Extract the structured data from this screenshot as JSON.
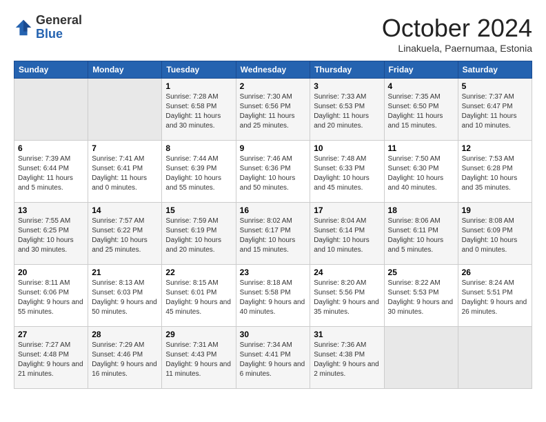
{
  "header": {
    "logo": {
      "line1": "General",
      "line2": "Blue"
    },
    "title": "October 2024",
    "subtitle": "Linakuela, Paernumaa, Estonia"
  },
  "days_of_week": [
    "Sunday",
    "Monday",
    "Tuesday",
    "Wednesday",
    "Thursday",
    "Friday",
    "Saturday"
  ],
  "weeks": [
    [
      {
        "day": "",
        "empty": true
      },
      {
        "day": "",
        "empty": true
      },
      {
        "day": "1",
        "sunrise": "Sunrise: 7:28 AM",
        "sunset": "Sunset: 6:58 PM",
        "daylight": "Daylight: 11 hours and 30 minutes."
      },
      {
        "day": "2",
        "sunrise": "Sunrise: 7:30 AM",
        "sunset": "Sunset: 6:56 PM",
        "daylight": "Daylight: 11 hours and 25 minutes."
      },
      {
        "day": "3",
        "sunrise": "Sunrise: 7:33 AM",
        "sunset": "Sunset: 6:53 PM",
        "daylight": "Daylight: 11 hours and 20 minutes."
      },
      {
        "day": "4",
        "sunrise": "Sunrise: 7:35 AM",
        "sunset": "Sunset: 6:50 PM",
        "daylight": "Daylight: 11 hours and 15 minutes."
      },
      {
        "day": "5",
        "sunrise": "Sunrise: 7:37 AM",
        "sunset": "Sunset: 6:47 PM",
        "daylight": "Daylight: 11 hours and 10 minutes."
      }
    ],
    [
      {
        "day": "6",
        "sunrise": "Sunrise: 7:39 AM",
        "sunset": "Sunset: 6:44 PM",
        "daylight": "Daylight: 11 hours and 5 minutes."
      },
      {
        "day": "7",
        "sunrise": "Sunrise: 7:41 AM",
        "sunset": "Sunset: 6:41 PM",
        "daylight": "Daylight: 11 hours and 0 minutes."
      },
      {
        "day": "8",
        "sunrise": "Sunrise: 7:44 AM",
        "sunset": "Sunset: 6:39 PM",
        "daylight": "Daylight: 10 hours and 55 minutes."
      },
      {
        "day": "9",
        "sunrise": "Sunrise: 7:46 AM",
        "sunset": "Sunset: 6:36 PM",
        "daylight": "Daylight: 10 hours and 50 minutes."
      },
      {
        "day": "10",
        "sunrise": "Sunrise: 7:48 AM",
        "sunset": "Sunset: 6:33 PM",
        "daylight": "Daylight: 10 hours and 45 minutes."
      },
      {
        "day": "11",
        "sunrise": "Sunrise: 7:50 AM",
        "sunset": "Sunset: 6:30 PM",
        "daylight": "Daylight: 10 hours and 40 minutes."
      },
      {
        "day": "12",
        "sunrise": "Sunrise: 7:53 AM",
        "sunset": "Sunset: 6:28 PM",
        "daylight": "Daylight: 10 hours and 35 minutes."
      }
    ],
    [
      {
        "day": "13",
        "sunrise": "Sunrise: 7:55 AM",
        "sunset": "Sunset: 6:25 PM",
        "daylight": "Daylight: 10 hours and 30 minutes."
      },
      {
        "day": "14",
        "sunrise": "Sunrise: 7:57 AM",
        "sunset": "Sunset: 6:22 PM",
        "daylight": "Daylight: 10 hours and 25 minutes."
      },
      {
        "day": "15",
        "sunrise": "Sunrise: 7:59 AM",
        "sunset": "Sunset: 6:19 PM",
        "daylight": "Daylight: 10 hours and 20 minutes."
      },
      {
        "day": "16",
        "sunrise": "Sunrise: 8:02 AM",
        "sunset": "Sunset: 6:17 PM",
        "daylight": "Daylight: 10 hours and 15 minutes."
      },
      {
        "day": "17",
        "sunrise": "Sunrise: 8:04 AM",
        "sunset": "Sunset: 6:14 PM",
        "daylight": "Daylight: 10 hours and 10 minutes."
      },
      {
        "day": "18",
        "sunrise": "Sunrise: 8:06 AM",
        "sunset": "Sunset: 6:11 PM",
        "daylight": "Daylight: 10 hours and 5 minutes."
      },
      {
        "day": "19",
        "sunrise": "Sunrise: 8:08 AM",
        "sunset": "Sunset: 6:09 PM",
        "daylight": "Daylight: 10 hours and 0 minutes."
      }
    ],
    [
      {
        "day": "20",
        "sunrise": "Sunrise: 8:11 AM",
        "sunset": "Sunset: 6:06 PM",
        "daylight": "Daylight: 9 hours and 55 minutes."
      },
      {
        "day": "21",
        "sunrise": "Sunrise: 8:13 AM",
        "sunset": "Sunset: 6:03 PM",
        "daylight": "Daylight: 9 hours and 50 minutes."
      },
      {
        "day": "22",
        "sunrise": "Sunrise: 8:15 AM",
        "sunset": "Sunset: 6:01 PM",
        "daylight": "Daylight: 9 hours and 45 minutes."
      },
      {
        "day": "23",
        "sunrise": "Sunrise: 8:18 AM",
        "sunset": "Sunset: 5:58 PM",
        "daylight": "Daylight: 9 hours and 40 minutes."
      },
      {
        "day": "24",
        "sunrise": "Sunrise: 8:20 AM",
        "sunset": "Sunset: 5:56 PM",
        "daylight": "Daylight: 9 hours and 35 minutes."
      },
      {
        "day": "25",
        "sunrise": "Sunrise: 8:22 AM",
        "sunset": "Sunset: 5:53 PM",
        "daylight": "Daylight: 9 hours and 30 minutes."
      },
      {
        "day": "26",
        "sunrise": "Sunrise: 8:24 AM",
        "sunset": "Sunset: 5:51 PM",
        "daylight": "Daylight: 9 hours and 26 minutes."
      }
    ],
    [
      {
        "day": "27",
        "sunrise": "Sunrise: 7:27 AM",
        "sunset": "Sunset: 4:48 PM",
        "daylight": "Daylight: 9 hours and 21 minutes."
      },
      {
        "day": "28",
        "sunrise": "Sunrise: 7:29 AM",
        "sunset": "Sunset: 4:46 PM",
        "daylight": "Daylight: 9 hours and 16 minutes."
      },
      {
        "day": "29",
        "sunrise": "Sunrise: 7:31 AM",
        "sunset": "Sunset: 4:43 PM",
        "daylight": "Daylight: 9 hours and 11 minutes."
      },
      {
        "day": "30",
        "sunrise": "Sunrise: 7:34 AM",
        "sunset": "Sunset: 4:41 PM",
        "daylight": "Daylight: 9 hours and 6 minutes."
      },
      {
        "day": "31",
        "sunrise": "Sunrise: 7:36 AM",
        "sunset": "Sunset: 4:38 PM",
        "daylight": "Daylight: 9 hours and 2 minutes."
      },
      {
        "day": "",
        "empty": true
      },
      {
        "day": "",
        "empty": true
      }
    ]
  ]
}
